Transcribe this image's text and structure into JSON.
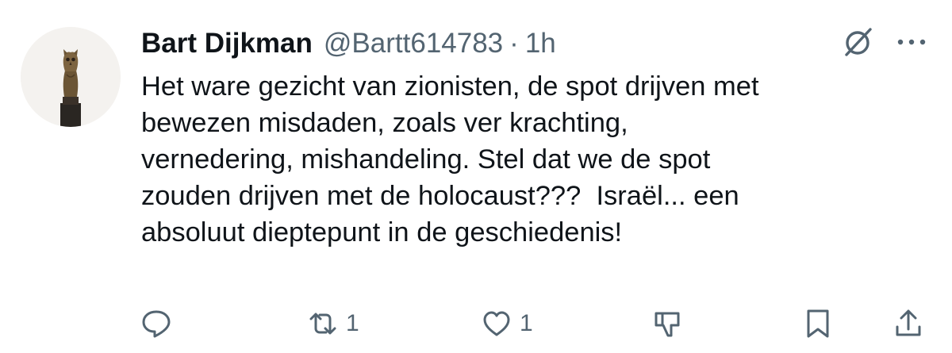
{
  "author": {
    "display_name": "Bart Dijkman",
    "handle": "@Bartt614783",
    "separator": "·",
    "time": "1h",
    "avatar_icon": "owl-statue-avatar"
  },
  "header_icons": {
    "grok": "grok-icon",
    "more": "more-icon"
  },
  "tweet": {
    "lines": [
      "Het ware gezicht van zionisten, de spot drijven met",
      "bewezen misdaden, zoals ver krachting,",
      "vernedering, mishandeling. Stel dat we de spot",
      "zouden drijven met de holocaust???  Israël... een",
      "absoluut dieptepunt in de geschiedenis!"
    ]
  },
  "actions": {
    "reply": {
      "icon": "reply-icon",
      "count": ""
    },
    "retweet": {
      "icon": "retweet-icon",
      "count": "1"
    },
    "like": {
      "icon": "heart-icon",
      "count": "1"
    },
    "dislike": {
      "icon": "thumbs-down-icon",
      "count": ""
    },
    "bookmark": {
      "icon": "bookmark-icon",
      "count": ""
    },
    "share": {
      "icon": "share-icon",
      "count": ""
    }
  },
  "colors": {
    "text": "#0f1419",
    "muted": "#536471",
    "background": "#ffffff"
  }
}
